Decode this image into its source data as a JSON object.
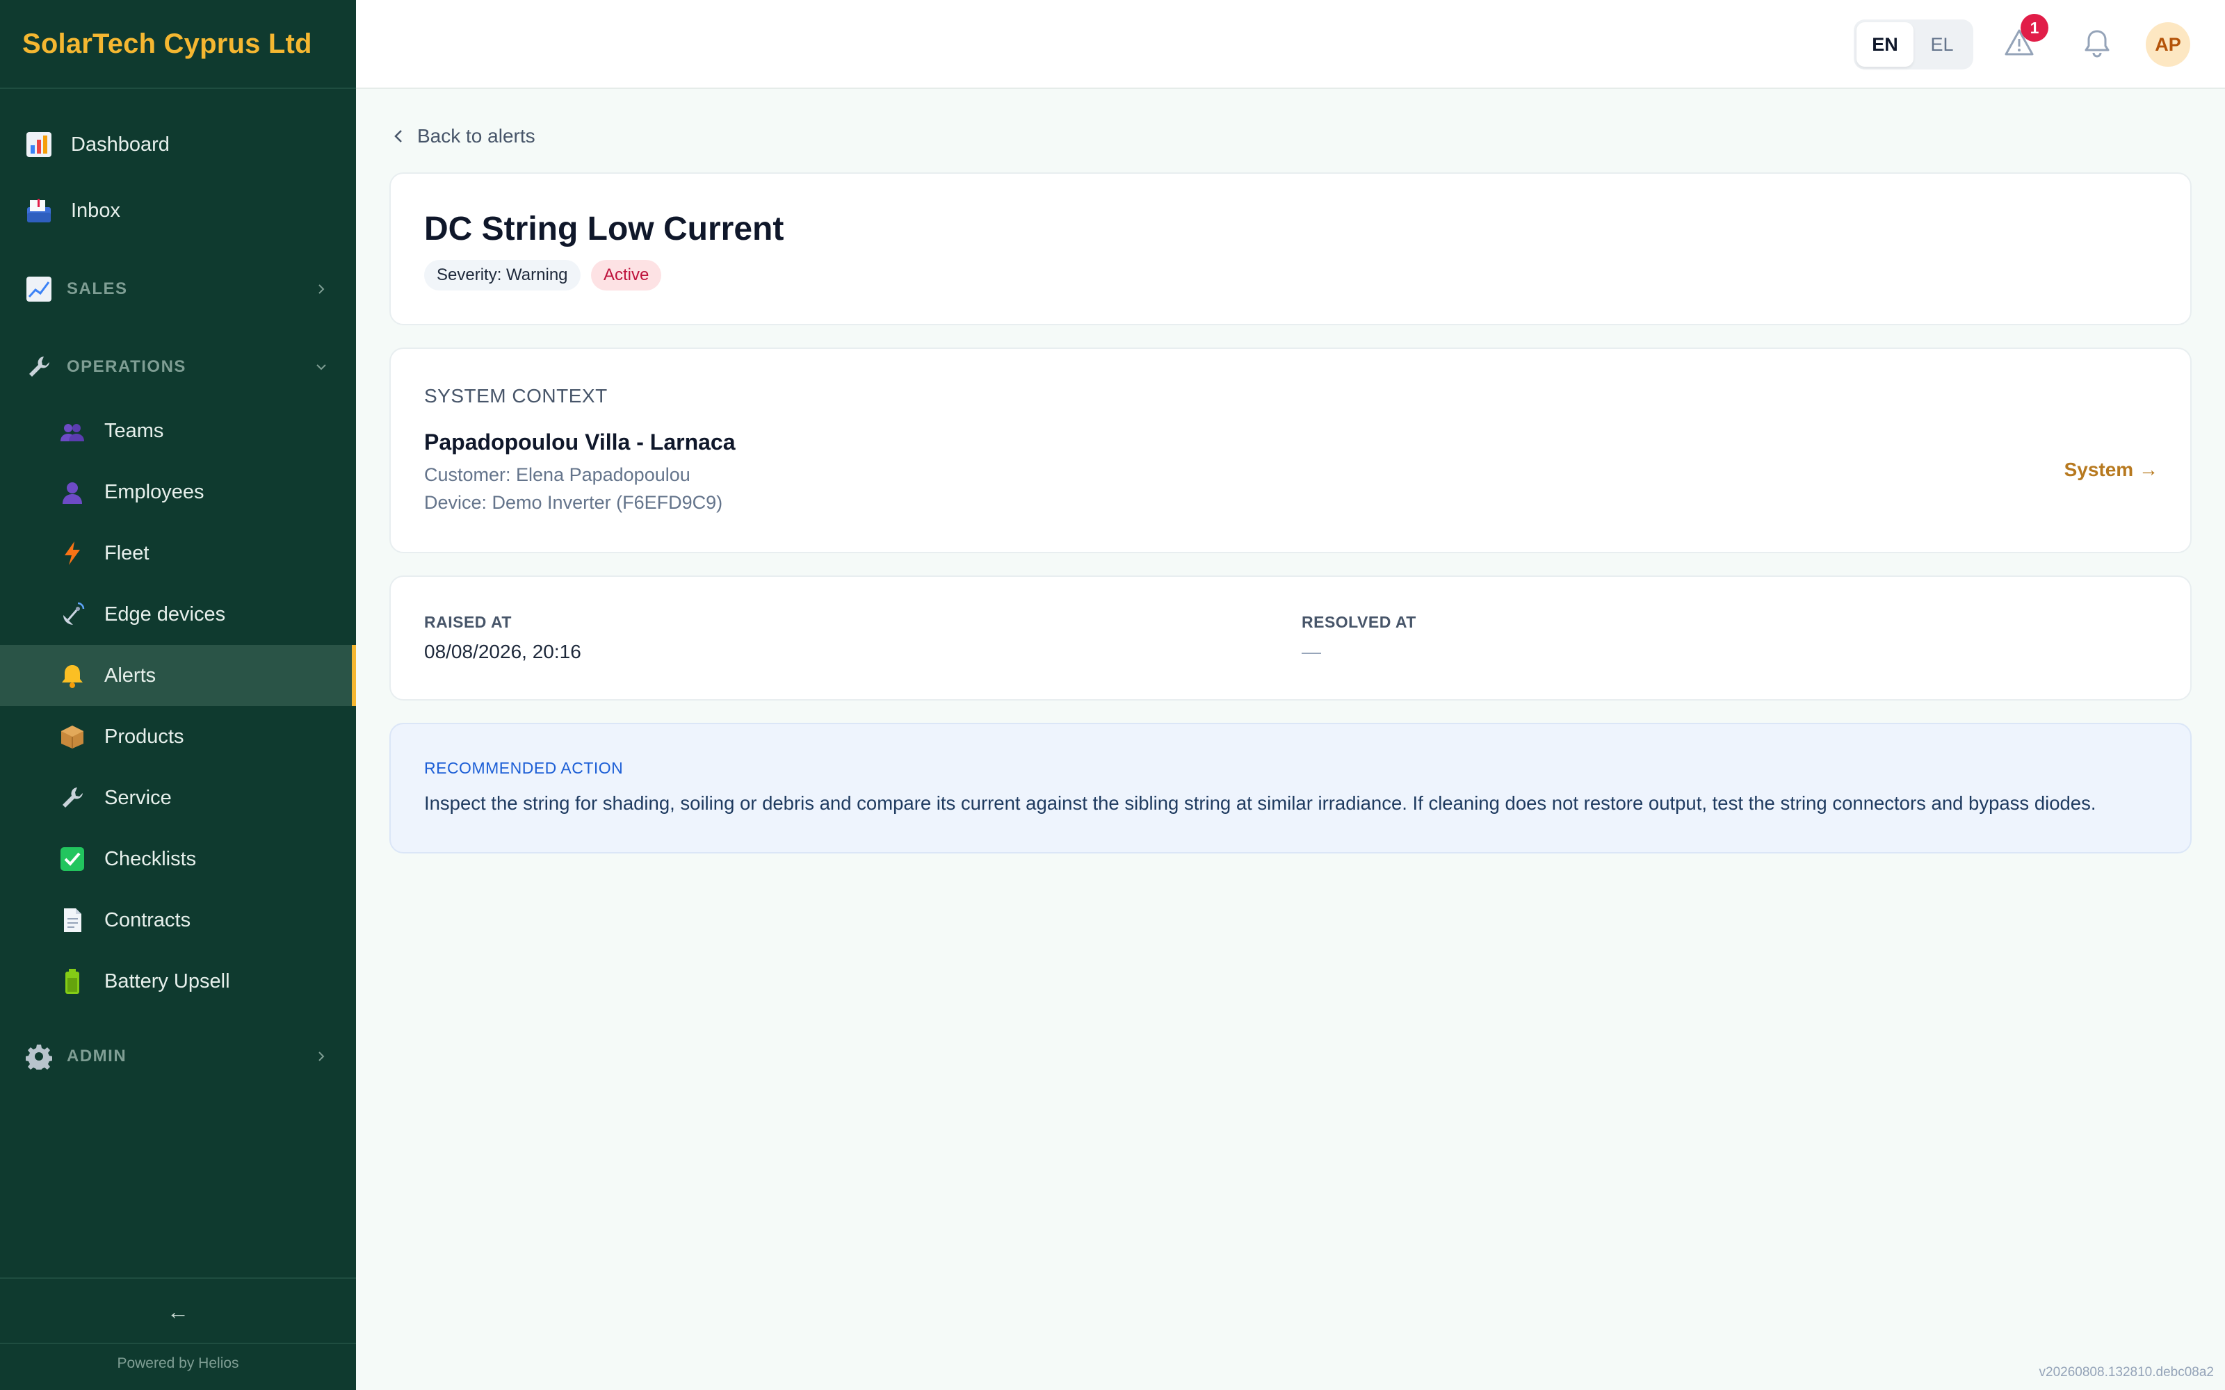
{
  "brand": {
    "name": "SolarTech Cyprus Ltd"
  },
  "sidebar": {
    "top_items": [
      {
        "label": "Dashboard",
        "icon": "bar-chart-icon"
      },
      {
        "label": "Inbox",
        "icon": "inbox-icon"
      }
    ],
    "sections": {
      "sales": {
        "label": "SALES",
        "icon": "trend-chart-icon",
        "expanded": false
      },
      "operations": {
        "label": "OPERATIONS",
        "icon": "wrench-icon",
        "expanded": true
      },
      "admin": {
        "label": "ADMIN",
        "icon": "gear-icon",
        "expanded": false
      }
    },
    "operations_items": [
      {
        "label": "Teams",
        "icon": "team-icon"
      },
      {
        "label": "Employees",
        "icon": "person-icon"
      },
      {
        "label": "Fleet",
        "icon": "lightning-icon"
      },
      {
        "label": "Edge devices",
        "icon": "satellite-icon"
      },
      {
        "label": "Alerts",
        "icon": "bell-icon",
        "active": true
      },
      {
        "label": "Products",
        "icon": "package-icon"
      },
      {
        "label": "Service",
        "icon": "wrench-icon"
      },
      {
        "label": "Checklists",
        "icon": "check-box-icon"
      },
      {
        "label": "Contracts",
        "icon": "document-icon"
      },
      {
        "label": "Battery Upsell",
        "icon": "battery-icon"
      }
    ],
    "collapse_glyph": "←",
    "powered_by": "Powered by Helios"
  },
  "topbar": {
    "languages": [
      "EN",
      "EL"
    ],
    "active_language": "EN",
    "alert_count": "1",
    "avatar_initials": "AP"
  },
  "page": {
    "back_label": "Back to alerts",
    "title": "DC String Low Current",
    "severity": "Severity: Warning",
    "status": "Active",
    "context": {
      "heading": "SYSTEM CONTEXT",
      "system_name": "Papadopoulou Villa - Larnaca",
      "customer": "Customer: Elena Papadopoulou",
      "device": "Device: Demo Inverter (F6EFD9C9)",
      "link": "System →"
    },
    "raised_label": "RAISED AT",
    "raised_value": "08/08/2026, 20:16",
    "resolved_label": "RESOLVED AT",
    "resolved_value": "—",
    "recommended_heading": "RECOMMENDED ACTION",
    "recommended_text": "Inspect the string for shading, soiling or debris and compare its current against the sibling string at similar irradiance. If cleaning does not restore output, test the string connectors and bypass diodes."
  },
  "version": "v20260808.132810.debc08a2",
  "colors": {
    "sidebar_bg": "#0f3a2f",
    "brand": "#f5b731",
    "active_item_bg": "#2a5447",
    "alert_badge": "#e11d48",
    "link": "#b7791f",
    "status_active": "#be123c"
  }
}
